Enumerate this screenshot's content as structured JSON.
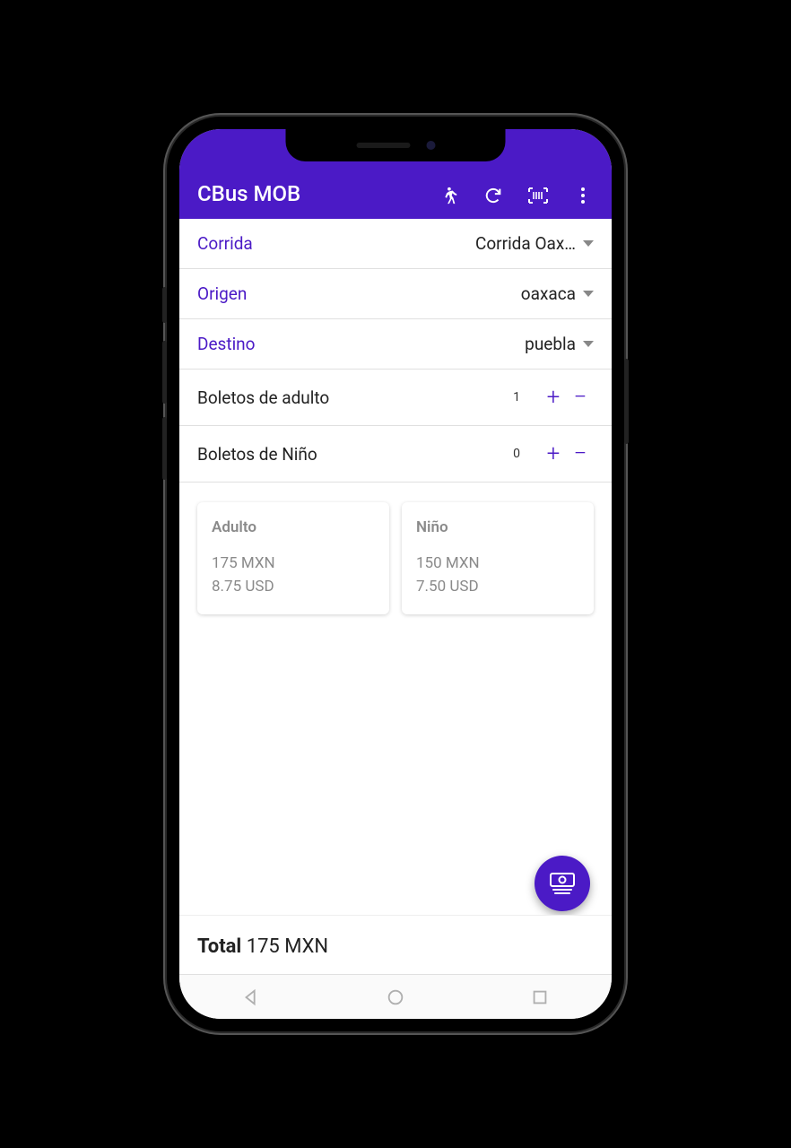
{
  "header": {
    "title": "CBus MOB"
  },
  "form": {
    "corrida_label": "Corrida",
    "corrida_value": "Corrida Oax…",
    "origen_label": "Origen",
    "origen_value": "oaxaca",
    "destino_label": "Destino",
    "destino_value": "puebla",
    "adult_label": "Boletos de adulto",
    "adult_count": "1",
    "child_label": "Boletos de Niño",
    "child_count": "0"
  },
  "prices": {
    "adult_title": "Adulto",
    "adult_mxn": "175 MXN",
    "adult_usd": "8.75 USD",
    "child_title": "Niño",
    "child_mxn": "150 MXN",
    "child_usd": "7.50 USD"
  },
  "total": {
    "label": "Total",
    "value": "175 MXN"
  }
}
